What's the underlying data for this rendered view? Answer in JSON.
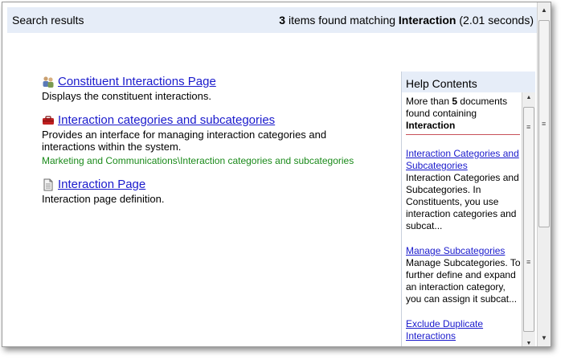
{
  "header": {
    "title": "Search results",
    "count": "3",
    "found_text": " items found matching ",
    "query": "Interaction",
    "time_text": " (2.01 seconds)"
  },
  "results": [
    {
      "icon": "people-icon",
      "title": "Constituent Interactions Page",
      "description": "Displays the constituent interactions.",
      "path": ""
    },
    {
      "icon": "toolbox-icon",
      "title": "Interaction categories and subcategories",
      "description": "Provides an interface for managing interaction categories and interactions within the system.",
      "path": "Marketing and Communications\\Interaction categories and subcategories"
    },
    {
      "icon": "page-icon",
      "title": "Interaction Page",
      "description": "Interaction page definition.",
      "path": ""
    }
  ],
  "help": {
    "title": "Help Contents",
    "summary_pre": "More than ",
    "summary_count": "5",
    "summary_mid": " documents found containing ",
    "summary_query": "Interaction",
    "entries": [
      {
        "title": "Interaction Categories and Subcategories",
        "text": "Interaction Categories and Subcategories. In Constituents, you use interaction categories and subcat..."
      },
      {
        "title": "Manage Subcategories",
        "text": "Manage Subcategories. To further define and expand an interaction category, you can assign it subcat..."
      },
      {
        "title": "Exclude Duplicate Interactions",
        "text": ""
      }
    ]
  },
  "colors": {
    "link": "#1a1acc",
    "path": "#1a8a1a",
    "header_bg": "#e6edf8",
    "divider": "#c8505a"
  }
}
